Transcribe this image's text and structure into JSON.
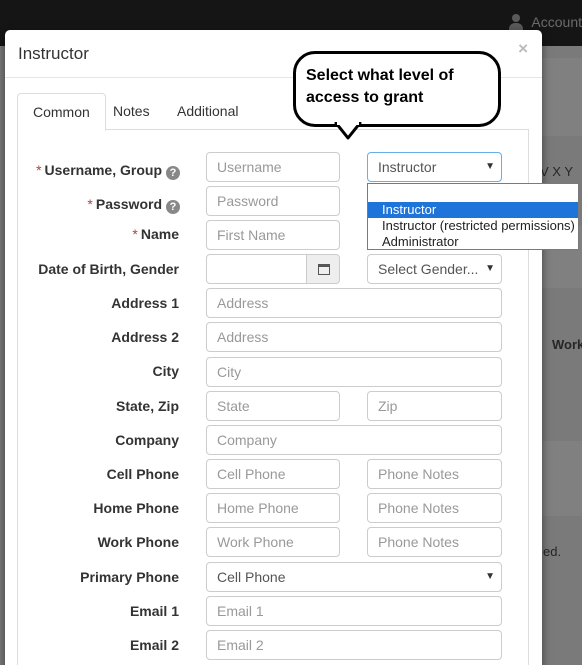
{
  "background": {
    "account_label": "Account",
    "letters": "V X Y",
    "word_work": "Work",
    "word_ed": "ed."
  },
  "modal": {
    "title": "Instructor",
    "close": "×"
  },
  "tabs": [
    {
      "label": "Common",
      "active": true
    },
    {
      "label": "Notes",
      "active": false
    },
    {
      "label": "Additional",
      "active": false
    }
  ],
  "callout": {
    "line1": "Select what level of",
    "line2": "access to grant"
  },
  "form": {
    "username_group_label": "Username, Group",
    "password_label": "Password",
    "name_label": "Name",
    "dob_gender_label": "Date of Birth, Gender",
    "address1_label": "Address 1",
    "address2_label": "Address 2",
    "city_label": "City",
    "state_zip_label": "State, Zip",
    "company_label": "Company",
    "cell_phone_label": "Cell Phone",
    "home_phone_label": "Home Phone",
    "work_phone_label": "Work Phone",
    "primary_phone_label": "Primary Phone",
    "email1_label": "Email 1",
    "email2_label": "Email 2",
    "required_marker": "*",
    "help_glyph": "?",
    "ph": {
      "username": "Username",
      "password": "Password",
      "first_name": "First Name",
      "address": "Address",
      "city": "City",
      "state": "State",
      "zip": "Zip",
      "company": "Company",
      "cell_phone": "Cell Phone",
      "home_phone": "Home Phone",
      "work_phone": "Work Phone",
      "phone_notes": "Phone Notes",
      "email1": "Email 1",
      "email2": "Email 2"
    },
    "group_selected": "Instructor",
    "gender_selected": "Select Gender...",
    "primary_phone_selected": "Cell Phone",
    "caret": "▼"
  },
  "group_options": [
    {
      "label": "Instructor",
      "highlighted": true
    },
    {
      "label": "Instructor (restricted permissions)",
      "highlighted": false
    },
    {
      "label": "Administrator",
      "highlighted": false
    }
  ],
  "colors": {
    "highlight": "#1e74d9",
    "required": "#a94442"
  }
}
